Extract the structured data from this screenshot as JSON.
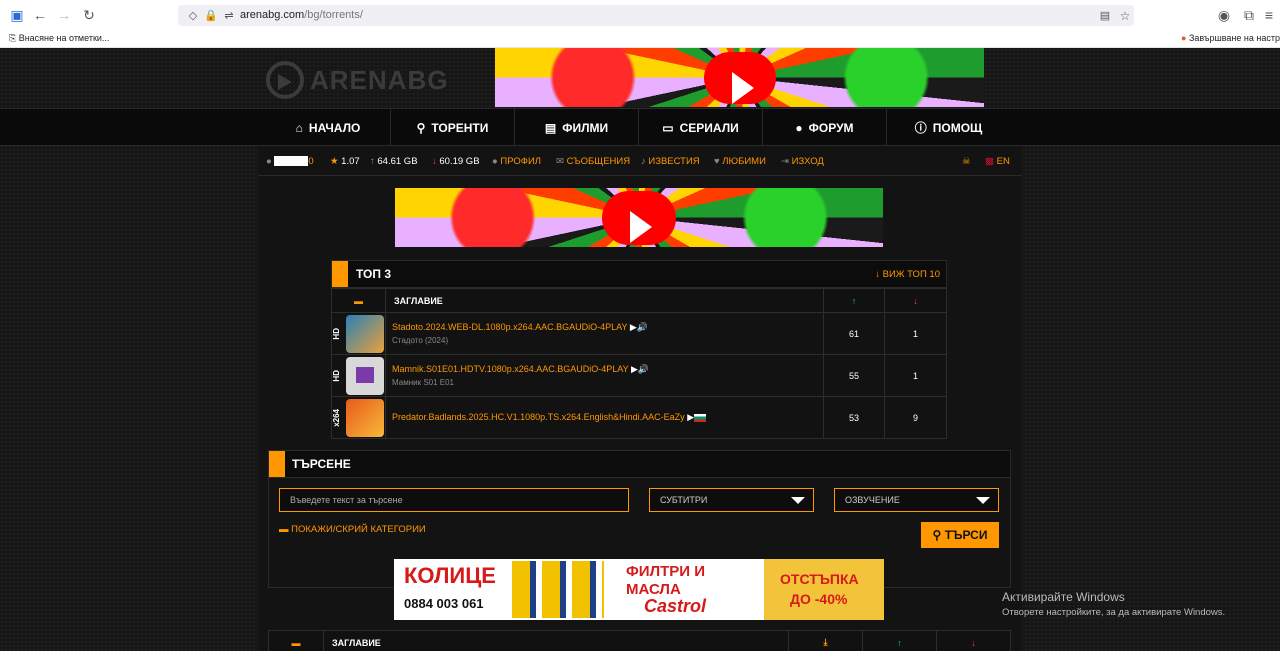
{
  "browser": {
    "url_domain": "arenabg.com",
    "url_path": "/bg/torrents/",
    "bookmark_import": "Внасяне на отметки...",
    "bookmark_right": "Завършване на настр..."
  },
  "site": {
    "logo_text": "ARENABG",
    "nav": [
      {
        "label": "НАЧАЛО",
        "icon": "home-icon",
        "glyph": "⌂"
      },
      {
        "label": "ТОРЕНТИ",
        "icon": "search-icon",
        "glyph": "🔍"
      },
      {
        "label": "ФИЛМИ",
        "icon": "film-icon",
        "glyph": "▤"
      },
      {
        "label": "СЕРИАЛИ",
        "icon": "tv-icon",
        "glyph": "▭"
      },
      {
        "label": "ФОРУМ",
        "icon": "chat-icon",
        "glyph": "💬"
      },
      {
        "label": "ПОМОЩ",
        "icon": "info-icon",
        "glyph": "ℹ"
      }
    ],
    "userbar": {
      "username_suffix": "0",
      "ratio": "1.07",
      "uploaded": "64.61 GB",
      "downloaded": "60.19 GB",
      "profile": "ПРОФИЛ",
      "messages": "СЪОБЩЕНИЯ",
      "notifications": "ИЗВЕСТИЯ",
      "favorites": "ЛЮБИМИ",
      "logout": "ИЗХОД",
      "lang": "EN"
    },
    "top3": {
      "title": "ТОП 3",
      "view_top10": "ВИЖ ТОП 10",
      "col_title": "ЗАГЛАВИЕ",
      "rows": [
        {
          "tag": "HD",
          "title": "Stadoto.2024.WEB-DL.1080p.x264.AAC.BGAUDiO-4PLAY",
          "subtitle": "Стадото (2024)",
          "seeders": "61",
          "leechers": "1",
          "thumb": "#2c7fb8"
        },
        {
          "tag": "HD",
          "title": "Mamnik.S01E01.HDTV.1080p.x264.AAC.BGAUDiO-4PLAY",
          "subtitle": "Мамник S01 E01",
          "seeders": "55",
          "leechers": "1",
          "thumb": "#d8d8d8"
        },
        {
          "tag": "x264",
          "title": "Predator.Badlands.2025.HC.V1.1080p.TS.x264.English&Hindi.AAC-EaZy",
          "subtitle": "",
          "seeders": "53",
          "leechers": "9",
          "thumb": "#e85a1a"
        }
      ]
    },
    "search": {
      "title": "ТЪРСЕНЕ",
      "placeholder": "Въведете текст за търсене",
      "subtitles": "СУБТИТРИ",
      "audio": "ОЗВУЧЕНИЕ",
      "categories_toggle": "ПОКАЖИ/СКРИЙ КАТЕГОРИИ",
      "button": "ТЪРСИ"
    },
    "ad": {
      "brand": "КОЛИЦЕ",
      "phone": "0884 003 061",
      "headline1": "ФИЛТРИ И",
      "headline2": "МАСЛА",
      "castrol": "Castrol",
      "promo1": "ОТСТЪПКА",
      "promo2": "ДО -40%"
    },
    "bottom_table": {
      "col_title": "ЗАГЛАВИЕ"
    }
  },
  "watermark": {
    "line1": "Активирайте Windows",
    "line2": "Отворете настройките, за да активирате Windows."
  },
  "colors": {
    "accent": "#ff9800",
    "up": "#2ecc40",
    "down": "#ff3b3b"
  }
}
